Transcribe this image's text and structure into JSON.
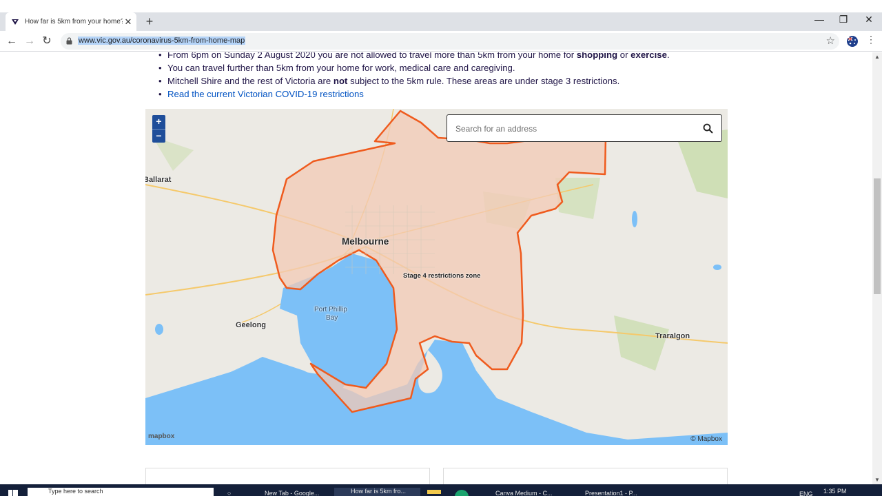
{
  "browser": {
    "tab_title": "How far is 5km from your home?",
    "tab_close": "✕",
    "new_tab": "+",
    "url": "www.vic.gov.au/coronavirus-5km-from-home-map",
    "star": "☆",
    "back": "←",
    "forward": "→",
    "reload": "↻",
    "minimize": "—",
    "maximize": "❐",
    "close": "✕",
    "menu": "⋮"
  },
  "page": {
    "bullets": {
      "b1_pre": "From 6pm on Sunday 2 August 2020 you are not allowed to travel more than 5km from your home for ",
      "b1_bold1": "shopping",
      "b1_mid": " or ",
      "b1_bold2": "exercise",
      "b1_end": ".",
      "b2": "You can travel further than 5km from your home for work, medical care and caregiving.",
      "b3_bold_pre": "Mitchell Shire and the rest of Victoria are ",
      "b3_bold": "not",
      "b3_post": " subject to the 5km rule. These areas are under stage 3 restrictions.",
      "b4_link": "Read the current Victorian COVID-19 restrictions"
    }
  },
  "map": {
    "zoom_in": "+",
    "zoom_out": "−",
    "search_placeholder": "Search for an address",
    "labels": {
      "ballarat": "Ballarat",
      "melbourne": "Melbourne",
      "zone": "Stage 4 restrictions zone",
      "bay1": "Port Phillip",
      "bay2": "Bay",
      "geelong": "Geelong",
      "traralgon": "Traralgon"
    },
    "mapbox_logo": "mapbox",
    "attribution": "© Mapbox",
    "colors": {
      "water": "#7cc0f7",
      "land": "#eceae4",
      "zone_fill": "#f3c9b5",
      "zone_stroke": "#ef5b1e",
      "park": "#c8dcaa"
    }
  },
  "taskbar": {
    "search": "Type here to search",
    "item1": "New Tab - Google...",
    "item2": "How far is 5km fro...",
    "item3": "Canva Medium - C...",
    "item4": "Presentation1 - P...",
    "lang": "ENG",
    "time": "1:35 PM"
  }
}
